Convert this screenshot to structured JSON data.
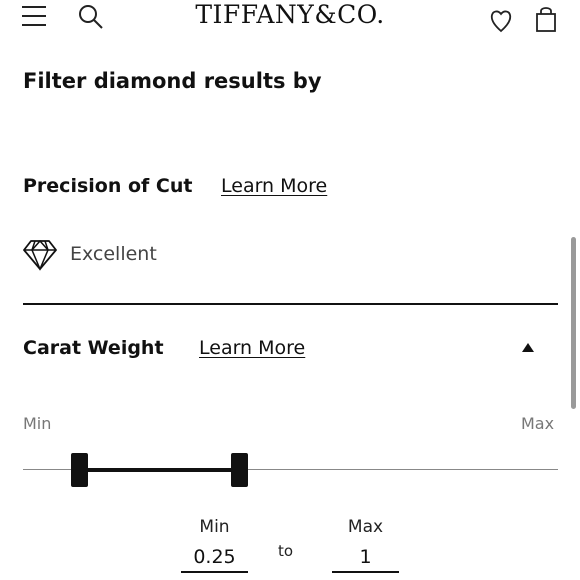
{
  "header": {
    "logo_text": "TIFFANY&CO.",
    "icons": [
      "hamburger-menu-icon",
      "search-icon",
      "heart-icon",
      "shopping-bag-icon"
    ]
  },
  "filter": {
    "title": "Filter diamond results by"
  },
  "cut": {
    "label": "Precision of Cut",
    "learn_more": "Learn More",
    "value": "Excellent",
    "icon": "diamond-icon"
  },
  "carat": {
    "label": "Carat Weight",
    "learn_more": "Learn More",
    "expanded": true,
    "slider": {
      "min_label": "Min",
      "max_label": "Max"
    },
    "min_field_label": "Min",
    "to_label": "to",
    "max_field_label": "Max",
    "min_value": "0.25",
    "max_value": "1"
  }
}
